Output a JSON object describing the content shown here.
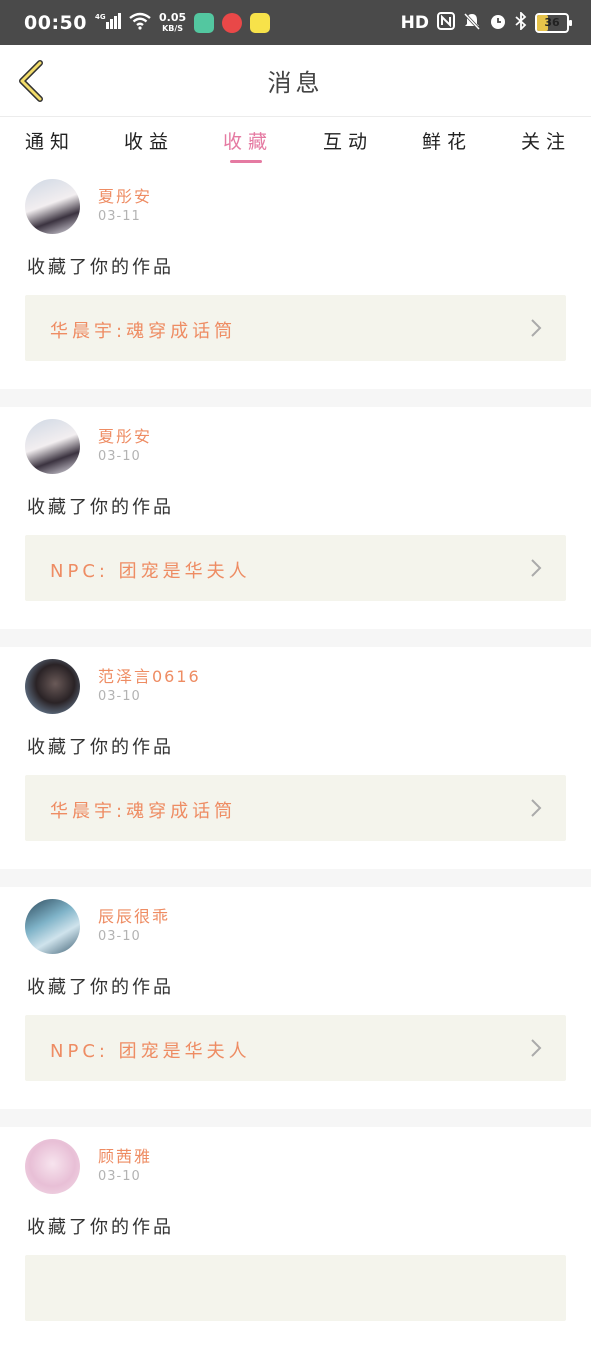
{
  "status_bar": {
    "time": "00:50",
    "network": "4G",
    "speed_value": "0.05",
    "speed_unit": "KB/S",
    "hd": "HD",
    "battery": "36",
    "battery_level": 0.36
  },
  "header": {
    "title": "消息"
  },
  "tabs": [
    {
      "label": "通知",
      "active": false
    },
    {
      "label": "收益",
      "active": false
    },
    {
      "label": "收藏",
      "active": true
    },
    {
      "label": "互动",
      "active": false
    },
    {
      "label": "鲜花",
      "active": false
    },
    {
      "label": "关注",
      "active": false
    }
  ],
  "messages": [
    {
      "username": "夏彤安",
      "date": "03-11",
      "action": "收藏了你的作品",
      "work": "华晨宇:魂穿成话筒"
    },
    {
      "username": "夏彤安",
      "date": "03-10",
      "action": "收藏了你的作品",
      "work": "NPC: 团宠是华夫人"
    },
    {
      "username": "范泽言0616",
      "date": "03-10",
      "action": "收藏了你的作品",
      "work": "华晨宇:魂穿成话筒"
    },
    {
      "username": "辰辰很乖",
      "date": "03-10",
      "action": "收藏了你的作品",
      "work": "NPC: 团宠是华夫人"
    },
    {
      "username": "顾茜雅",
      "date": "03-10",
      "action": "收藏了你的作品",
      "work": ""
    }
  ],
  "colors": {
    "accent": "#e57aa2",
    "username": "#ee8c63",
    "work_bg": "#f4f4ec"
  }
}
